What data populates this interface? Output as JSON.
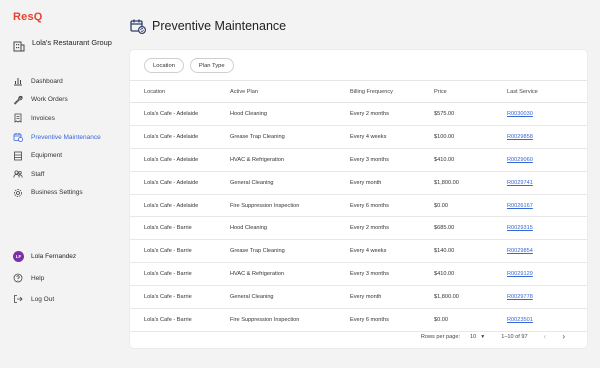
{
  "app": {
    "logo": "ResQ"
  },
  "company": {
    "name": "Lola's Restaurant Group",
    "icon": "building-icon"
  },
  "nav": [
    {
      "label": "Dashboard",
      "icon": "chart-icon"
    },
    {
      "label": "Work Orders",
      "icon": "wrench-icon"
    },
    {
      "label": "Invoices",
      "icon": "invoice-icon"
    },
    {
      "label": "Preventive Maintenance",
      "icon": "calendar-refresh-icon",
      "active": true
    },
    {
      "label": "Equipment",
      "icon": "equipment-icon"
    },
    {
      "label": "Staff",
      "icon": "staff-icon"
    },
    {
      "label": "Business Settings",
      "icon": "gear-icon"
    }
  ],
  "user": {
    "initials": "LF",
    "name": "Lola Fernandez",
    "avatar_color": "#7b2fa8"
  },
  "help": {
    "label": "Help"
  },
  "logout": {
    "label": "Log Out"
  },
  "page": {
    "title": "Preventive Maintenance"
  },
  "filters": {
    "location": "Location",
    "plan_type": "Plan Type"
  },
  "table": {
    "headers": [
      "Location",
      "Active Plan",
      "Billing Frequency",
      "Price",
      "Last Service"
    ],
    "rows": [
      [
        "Lola's Cafe - Adelaide",
        "Hood Cleaning",
        "Every 2 months",
        "$575.00",
        "R0030030"
      ],
      [
        "Lola's Cafe - Adelaide",
        "Grease Trap Cleaning",
        "Every 4 weeks",
        "$100.00",
        "R0029858"
      ],
      [
        "Lola's Cafe - Adelaide",
        "HVAC & Refrigeration",
        "Every 3 months",
        "$410.00",
        "R0029060"
      ],
      [
        "Lola's Cafe - Adelaide",
        "General Cleaning",
        "Every month",
        "$1,800.00",
        "R0029741"
      ],
      [
        "Lola's Cafe - Adelaide",
        "Fire Suppression Inspection",
        "Every 6 months",
        "$0.00",
        "R0026167"
      ],
      [
        "Lola's Cafe - Barrie",
        "Hood Cleaning",
        "Every 2 months",
        "$685.00",
        "R0029315"
      ],
      [
        "Lola's Cafe - Barrie",
        "Grease Trap Cleaning",
        "Every 4 weeks",
        "$140.00",
        "R0029854"
      ],
      [
        "Lola's Cafe - Barrie",
        "HVAC & Refrigeration",
        "Every 3 months",
        "$410.00",
        "R0029129"
      ],
      [
        "Lola's Cafe - Barrie",
        "General Cleaning",
        "Every month",
        "$1,800.00",
        "R0029778"
      ],
      [
        "Lola's Cafe - Barrie",
        "Fire Suppression Inspection",
        "Every 6 months",
        "$0.00",
        "R0023501"
      ]
    ]
  },
  "pagination": {
    "rows_per_page_label": "Rows per page:",
    "rows_per_page": "10",
    "range": "1–10 of 97",
    "prev_icon": "chevron-left-icon",
    "next_icon": "chevron-right-icon"
  },
  "colors": {
    "brand": "#e8412e",
    "accent": "#3867d6"
  }
}
